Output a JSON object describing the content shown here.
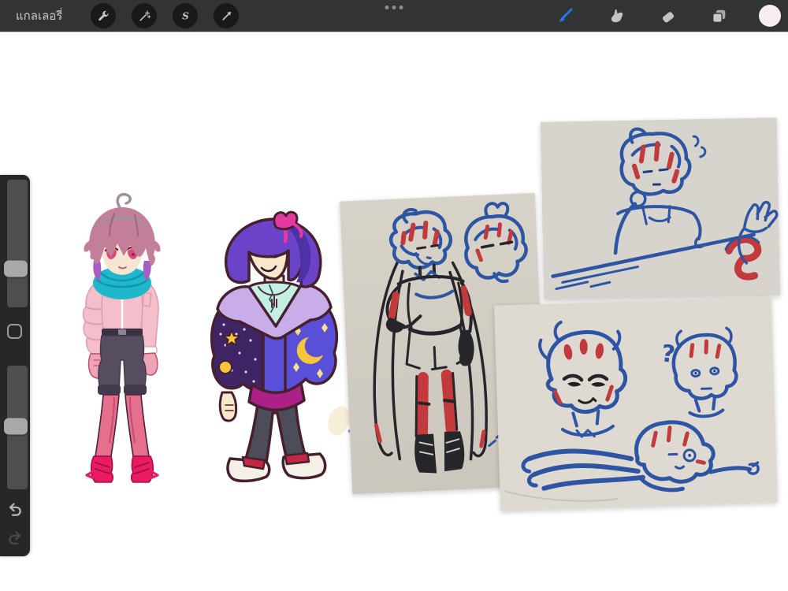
{
  "topbar": {
    "gallery_label": "แกลเลอรี่",
    "drag_handle": "three-dots",
    "left_tools": [
      {
        "name": "actions",
        "icon": "wrench-icon"
      },
      {
        "name": "adjustments",
        "icon": "magic-wand-icon"
      },
      {
        "name": "selection",
        "icon": "s-ribbon-icon"
      },
      {
        "name": "transform",
        "icon": "arrow-cursor-icon"
      }
    ],
    "right_tools": [
      {
        "name": "paint",
        "icon": "brush-icon",
        "active": true
      },
      {
        "name": "smudge",
        "icon": "smudge-finger-icon",
        "active": false
      },
      {
        "name": "erase",
        "icon": "eraser-icon",
        "active": false
      },
      {
        "name": "layers",
        "icon": "layers-icon",
        "active": false
      },
      {
        "name": "color",
        "icon": "color-swatch-circle",
        "active": false
      }
    ]
  },
  "sidebar": {
    "sliders": [
      {
        "name": "brush-size-slider",
        "handle_percent": 70
      },
      {
        "name": "brush-opacity-slider",
        "handle_percent": 49
      }
    ],
    "modify_button": {
      "name": "modify-button",
      "icon": "rounded-square-outline-icon"
    },
    "history": [
      {
        "name": "undo",
        "icon": "undo-arrow-icon",
        "enabled": true
      },
      {
        "name": "redo",
        "icon": "redo-arrow-icon",
        "enabled": false
      }
    ]
  },
  "canvas": {
    "artworks": [
      {
        "name": "character-pink-hair-teal-scarf",
        "medium": "digital-illustration"
      },
      {
        "name": "character-purple-bob-star-jacket",
        "medium": "digital-illustration"
      },
      {
        "name": "photo-marker-fullbody-and-head",
        "medium": "photo-of-paper-sketch"
      },
      {
        "name": "photo-marker-leaning-on-table",
        "medium": "photo-of-paper-sketch"
      },
      {
        "name": "photo-marker-expression-heads",
        "medium": "photo-of-paper-sketch"
      }
    ]
  },
  "theme": {
    "canvas-white": "#ffffff",
    "bar-bg": "#323335",
    "bar-circle": "#19191a",
    "icon-gray": "#c3c3c3",
    "icon-dim": "#8e8e8e",
    "accent-blue": "#2577e5",
    "swatch-pink": "#f8edf0",
    "side-bg": "#272728",
    "side-track": "#4e4e4e",
    "side-handle": "#a8a8a8",
    "undo-gray": "#b9b9b9",
    "redo-gray": "#4a4a4a",
    "paper-a": "#d8d3c9",
    "paper-b": "#d7d4cd",
    "paper-c": "#dedad2",
    "paper-line": "#c9c3b8",
    "ink-blue": "#2d55a4",
    "ink-blue-dark": "#1d3d85",
    "ink-red": "#c23a3c",
    "ink-black": "#26262a",
    "c1-hair": "#c37e99",
    "c1-hair-top": "#a48d9e",
    "c1-hair-dk": "#a2637e",
    "c1-purple": "#a55fc2",
    "c1-skin": "#f7e4d1",
    "c1-eye": "#d94a7c",
    "c1-lash": "#6d2742",
    "c1-scarf": "#20b7cc",
    "c1-scarf-dk": "#0f97ad",
    "c1-jkt": "#f4bfcb",
    "c1-jkt-dk": "#dd9cb0",
    "c1-shorts": "#574d61",
    "c1-shorts-dk": "#423a4c",
    "c1-belt": "#393142",
    "c1-leg": "#e76f8e",
    "c1-leg-dk": "#c04e6c",
    "c1-boot": "#eb1b63",
    "c1-boot-dk": "#a31147",
    "c1-line": "#47243a",
    "c2-line": "#46202f",
    "c2-hair": "#6b43c8",
    "c2-hair-dk": "#4f31a6",
    "c2-bow": "#e23a9e",
    "c2-skin": "#f7e8c9",
    "c2-skin-dk": "#caa87f",
    "c2-shirt": "#c3f0e3",
    "c2-fur": "#c8ade9",
    "c2-jl": "#3f2566",
    "c2-jr": "#5a50d8",
    "c2-star": "#f6c53a",
    "c2-star2": "#f8e08a",
    "c2-trim": "#ad2087",
    "c2-pants": "#4d4d59",
    "c2-shoe": "#f4efe7",
    "c2-red": "#c22743",
    "blob-cream": "#f7efd9",
    "blob-dot": "#5a6ad0"
  }
}
